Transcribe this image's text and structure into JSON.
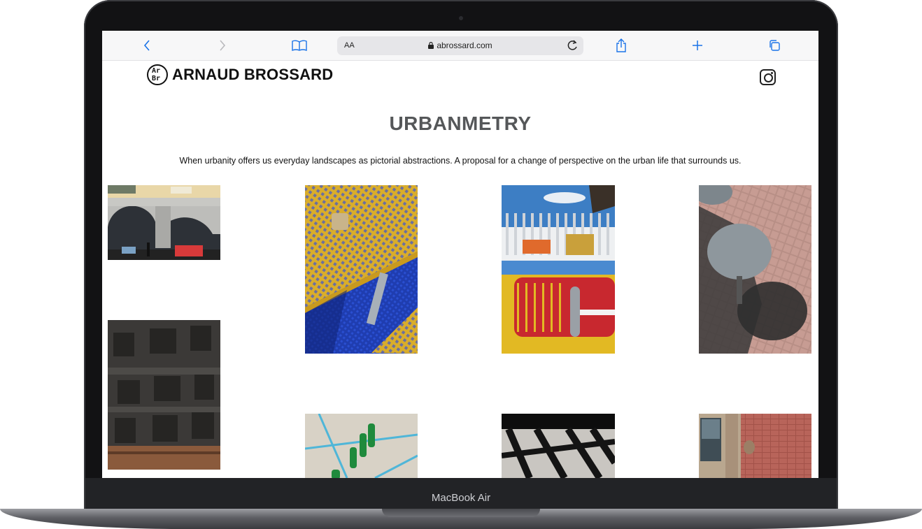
{
  "device": {
    "label": "MacBook Air"
  },
  "browser": {
    "aa_label": "AA",
    "url": "abrossard.com",
    "icons": [
      "back-icon",
      "forward-icon",
      "bookmarks-icon",
      "lock-icon",
      "reload-icon",
      "share-icon",
      "new-tab-icon",
      "tabs-icon"
    ]
  },
  "site": {
    "logo_mark_top": "Ar",
    "logo_mark_bottom": "Br",
    "logo_name": "ARNAUD BROSSARD",
    "instagram_icon": "instagram-icon"
  },
  "page": {
    "title": "URBANMETRY",
    "description": "When urbanity offers us everyday landscapes as pictorial abstractions. A proposal for a change of perspective on the urban life that surrounds us."
  },
  "gallery": [
    {
      "subject": "arches"
    },
    {
      "subject": "yellow-mesh-table"
    },
    {
      "subject": "fence-reflection"
    },
    {
      "subject": "round-tables-shadow"
    },
    {
      "subject": "concrete-blocks"
    },
    {
      "subject": "green-bollards"
    },
    {
      "subject": "chair-shadows"
    },
    {
      "subject": "brick-facade"
    }
  ],
  "colors": {
    "accent": "#1a73e8",
    "title_gray": "#555759"
  }
}
